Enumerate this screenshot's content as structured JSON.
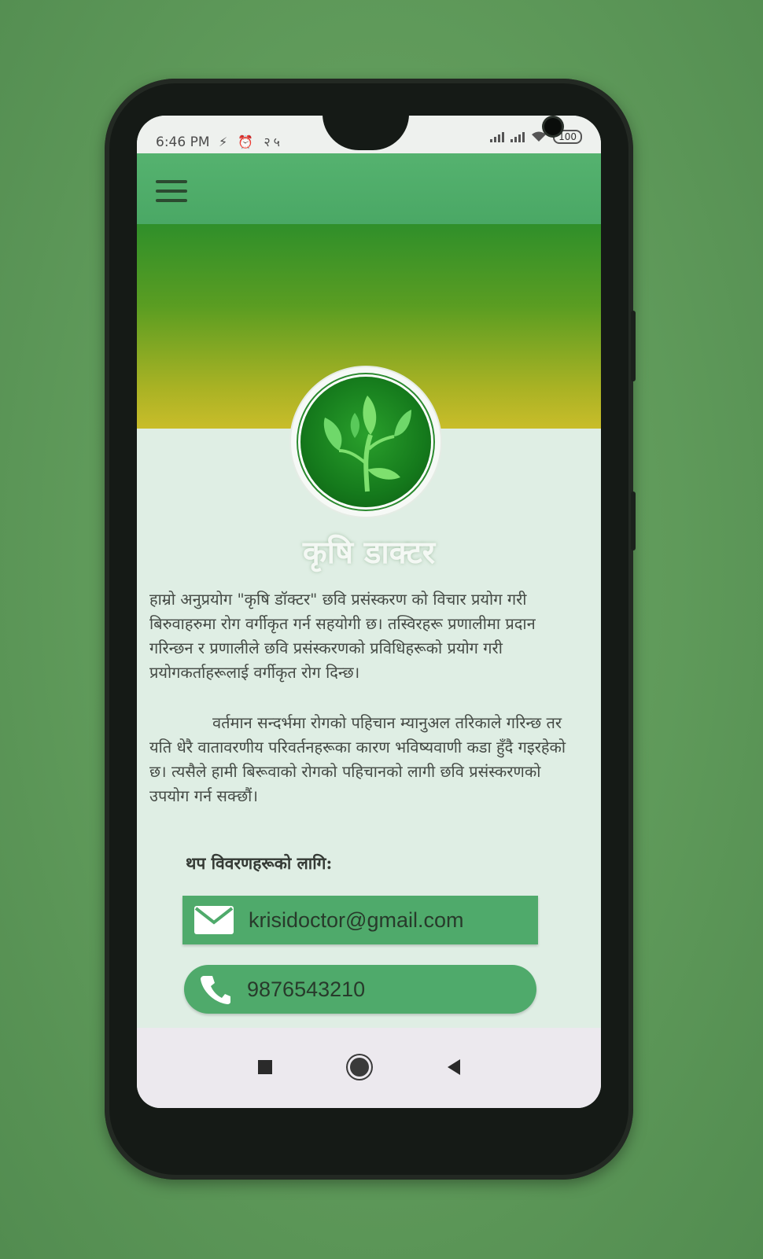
{
  "status_bar": {
    "time": "6:46 PM",
    "left_indicators": "⚡ ⏰ २५",
    "battery": "100"
  },
  "brand": {
    "title": "कृषि डाक्टर"
  },
  "content": {
    "paragraph_1": "हाम्रो अनुप्रयोग \"कृषि डॉक्टर\" छवि प्रसंस्करण को विचार प्रयोग गरी बिरुवाहरुमा रोग वर्गीकृत गर्न सहयोगी छ। तस्विरहरू प्रणालीमा प्रदान गरिन्छन र प्रणालीले छवि प्रसंस्करणको प्रविधिहरूको प्रयोग गरी प्रयोगकर्ताहरूलाई वर्गीकृत रोग दिन्छ।",
    "paragraph_2": "वर्तमान सन्दर्भमा रोगको पहिचान म्यानुअल तरिकाले गरिन्छ तर यति धेरै वातावरणीय परिवर्तनहरूका कारण भविष्यवाणी कडा हुँदै गइरहेको छ। त्यसैले हामी बिरूवाको रोगको पहिचानको लागी छवि प्रसंस्करणको उपयोग गर्न सक्छौं।",
    "more_details_heading": "थप विवरणहरूको लागि:"
  },
  "contact": {
    "email": "krisidoctor@gmail.com",
    "phone": "9876543210"
  },
  "colors": {
    "app_bar": "#4aa865",
    "contact_button": "#4faa6b",
    "hero_top": "#2f8f2a",
    "hero_bottom": "#c9bd2a"
  },
  "icons": [
    "menu-icon",
    "leaf-logo-icon",
    "email-icon",
    "phone-icon",
    "recents-icon",
    "home-icon",
    "back-icon"
  ]
}
